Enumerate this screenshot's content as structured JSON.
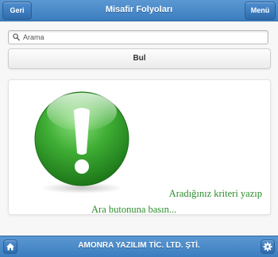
{
  "header": {
    "title": "Misafir Folyoları",
    "back_label": "Geri",
    "menu_label": "Menü"
  },
  "search": {
    "placeholder": "Arama",
    "value": "",
    "icon": "search-icon"
  },
  "find_button": {
    "label": "Bul"
  },
  "message": {
    "icon": "exclamation-icon",
    "line1": "Aradığınız kriteri yazıp",
    "line2": "Ara butonuna basın..."
  },
  "footer": {
    "title": "AMONRA YAZILIM TİC. LTD. ŞTİ.",
    "home_icon": "home-icon",
    "settings_icon": "gear-icon"
  },
  "colors": {
    "bar_blue": "#3c7dc0",
    "message_green": "#2c8c2c",
    "icon_green": "#1f8a1f"
  }
}
